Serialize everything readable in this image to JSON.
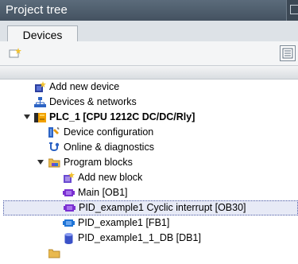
{
  "panel": {
    "title": "Project tree"
  },
  "tabs": [
    {
      "label": "Devices"
    }
  ],
  "tree": {
    "items": [
      {
        "label": "Add new device"
      },
      {
        "label": "Devices & networks"
      },
      {
        "label": "PLC_1 [CPU 1212C DC/DC/Rly]"
      },
      {
        "label": "Device configuration"
      },
      {
        "label": "Online & diagnostics"
      },
      {
        "label": "Program blocks"
      },
      {
        "label": "Add new block"
      },
      {
        "label": "Main [OB1]"
      },
      {
        "label": "PID_example1 Cyclic interrupt [OB30]"
      },
      {
        "label": "PID_example1 [FB1]"
      },
      {
        "label": "PID_example1_1_DB [DB1]"
      }
    ]
  },
  "colors": {
    "title_bar": "#4f5e6d",
    "selection": "#e7eaf6",
    "ob_block": "#7a2fd1",
    "fb_block": "#1f74d6",
    "db_block": "#3b52c8",
    "folder": "#e9b94e",
    "plc_body": "#f2a100"
  },
  "icons": [
    "detail-view-icon",
    "new-device-icon",
    "add-new-device-icon",
    "devices-networks-icon",
    "plc-icon",
    "device-configuration-icon",
    "online-diagnostics-icon",
    "program-blocks-folder-icon",
    "add-new-block-icon",
    "ob-block-icon",
    "fb-block-icon",
    "db-block-icon"
  ]
}
